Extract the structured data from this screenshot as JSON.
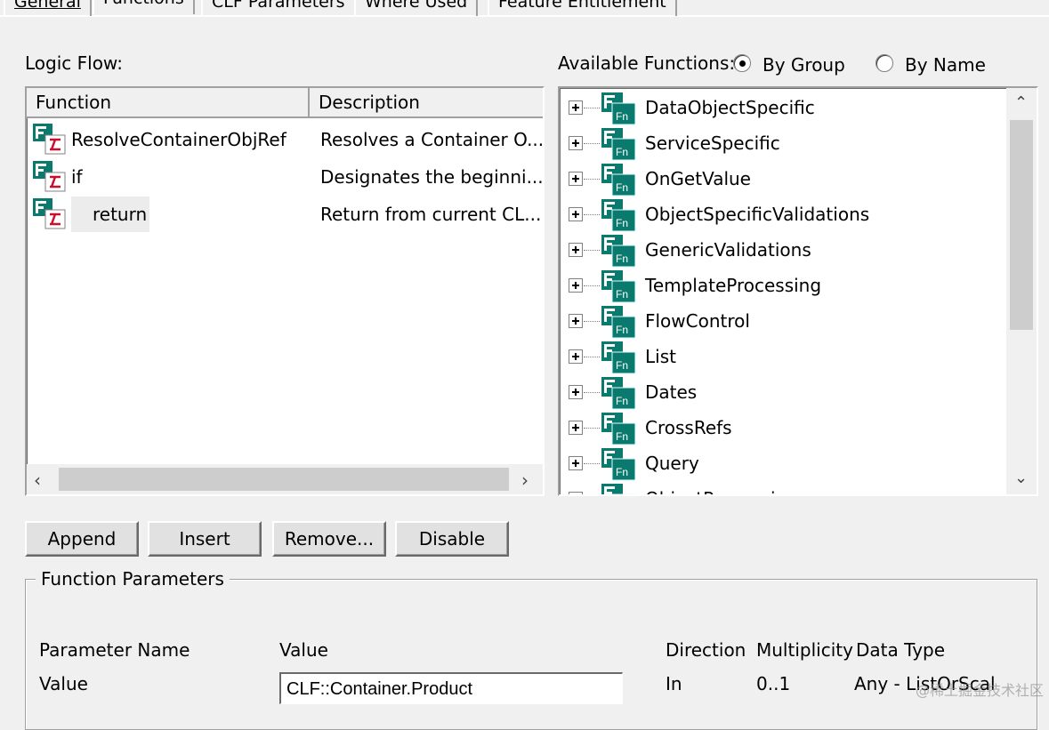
{
  "tabs": [
    {
      "label": "General"
    },
    {
      "label": "Functions"
    },
    {
      "label": "CLF Parameters"
    },
    {
      "label": "Where Used"
    },
    {
      "label": "Feature Entitlement"
    }
  ],
  "logic_flow": {
    "label": "Logic Flow:",
    "columns": [
      "Function",
      "Description"
    ],
    "rows": [
      {
        "function": "ResolveContainerObjRef",
        "description": "Resolves a Container O..."
      },
      {
        "function": "if",
        "description": "Designates the beginni..."
      },
      {
        "function": "return",
        "description": "Return from current CL..."
      }
    ]
  },
  "available_functions": {
    "label": "Available Functions:",
    "options": [
      {
        "label": "By Group",
        "selected": true
      },
      {
        "label": "By Name",
        "selected": false
      }
    ],
    "groups": [
      "DataObjectSpecific",
      "ServiceSpecific",
      "OnGetValue",
      "ObjectSpecificValidations",
      "GenericValidations",
      "TemplateProcessing",
      "FlowControl",
      "List",
      "Dates",
      "CrossRefs",
      "Query",
      "ObjectProcessing"
    ]
  },
  "buttons": {
    "append": "Append",
    "insert": "Insert",
    "remove": "Remove...",
    "disable": "Disable"
  },
  "function_parameters": {
    "title": "Function Parameters",
    "headers": {
      "name": "Parameter Name",
      "value": "Value",
      "direction": "Direction",
      "multiplicity": "Multiplicity",
      "data_type": "Data Type"
    },
    "row": {
      "name": "Value",
      "value": "CLF::Container.Product",
      "direction": "In",
      "multiplicity": "0..1",
      "data_type": "Any - ListOrScal"
    }
  },
  "watermark": "@稀土掘金技术社区",
  "colors": {
    "background": "#f0f0f0",
    "icon_teal": "#0a7a6e",
    "icon_red": "#c8102e"
  }
}
